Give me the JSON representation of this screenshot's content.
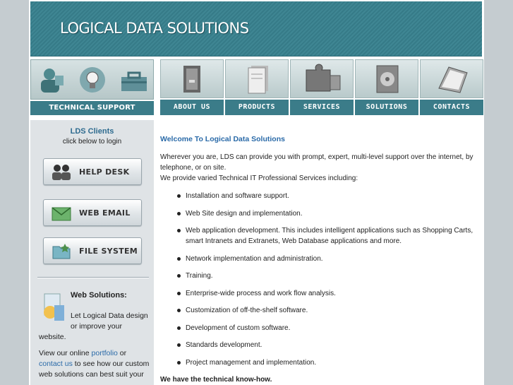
{
  "banner": {
    "title": "LOGICAL DATA SOLUTIONS"
  },
  "tech_support": {
    "label": "TECHNICAL SUPPORT",
    "icons": [
      "user-icon",
      "lightbulb-icon",
      "toolbox-icon"
    ]
  },
  "nav": {
    "items": [
      {
        "label": "ABOUT US",
        "icon": "binder-icon"
      },
      {
        "label": "PRODUCTS",
        "icon": "document-stack-icon"
      },
      {
        "label": "SERVICES",
        "icon": "puzzle-icon"
      },
      {
        "label": "SOLUTIONS",
        "icon": "cd-case-icon"
      },
      {
        "label": "CONTACTS",
        "icon": "address-book-icon"
      }
    ]
  },
  "sidebar": {
    "clients_title": "LDS Clients",
    "clients_sub": "click below to login",
    "buttons": [
      {
        "label": "HELP DESK",
        "icon": "people-icon"
      },
      {
        "label": "WEB EMAIL",
        "icon": "envelope-icon"
      },
      {
        "label": "FILE SYSTEM",
        "icon": "folder-icon"
      }
    ],
    "web_solutions": {
      "title": "Web Solutions:",
      "line1": "Let Logical Data design or improve your",
      "line1_tail": "website.",
      "p2_before": "View our online ",
      "p2_link1": "portfolio",
      "p2_mid": " or ",
      "p2_link2": "contact us",
      "p2_after": " to see how our custom web solutions can best suit your"
    }
  },
  "main": {
    "welcome": "Welcome To Logical Data Solutions",
    "intro1": "Wherever you are, LDS can provide you with prompt, expert, multi-level support over the internet, by telephone, or on site.",
    "intro2": "We provide varied Technical IT Professional Services including:",
    "services": [
      "Installation and software support.",
      "Web Site design and implementation.",
      "Web application development. This includes intelligent applications such as Shopping Carts, smart Intranets and Extranets, Web Database applications and more.",
      "Network implementation and administration.",
      "Training.",
      "Enterprise-wide process and work flow analysis.",
      "Customization of off-the-shelf software.",
      "Development of custom software.",
      "Standards development.",
      "Project management and implementation."
    ],
    "tagline": "We have the technical know-how."
  },
  "colors": {
    "teal": "#3b7c89",
    "link": "#2a6aa8",
    "sidebar_bg": "#dfe3e6"
  }
}
